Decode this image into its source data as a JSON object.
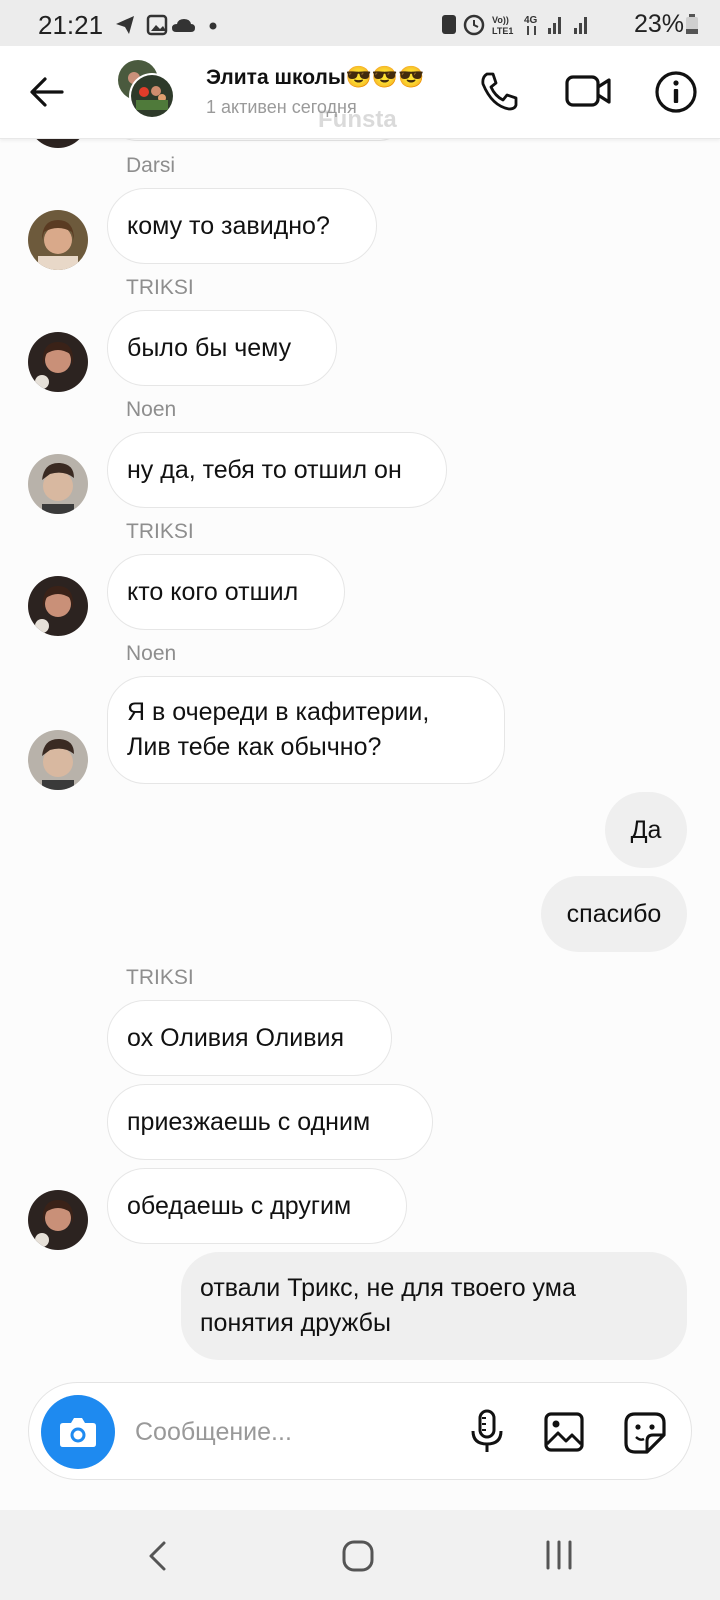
{
  "status_bar": {
    "time": "21:21",
    "battery": "23%",
    "network": [
      "Vo) LTE1",
      "4G"
    ]
  },
  "header": {
    "title": "Элита школы😎😎😎",
    "subtitle": "1 активен сегодня",
    "watermark": "Funsta"
  },
  "messages": [
    {
      "sender": "Darsi",
      "text": "кому то завидно?",
      "direction": "in"
    },
    {
      "sender": "TRIKSI",
      "text": "было бы чему",
      "direction": "in"
    },
    {
      "sender": "Noen",
      "text": "ну да, тебя то отшил он",
      "direction": "in"
    },
    {
      "sender": "TRIKSI",
      "text": "кто кого отшил",
      "direction": "in"
    },
    {
      "sender": "Noen",
      "lines": [
        "Я в очереди в кафитерии,",
        "Лив тебе как обычно?"
      ],
      "direction": "in"
    },
    {
      "text": "Да",
      "direction": "out"
    },
    {
      "text": "спасибо",
      "direction": "out"
    },
    {
      "sender": "TRIKSI",
      "text": "ох Оливия Оливия",
      "direction": "in"
    },
    {
      "text": "приезжаешь с одним",
      "direction": "in"
    },
    {
      "text": "обедаешь с другим",
      "direction": "in"
    },
    {
      "lines": [
        "отвали Трикс, не для твоего ума",
        "понятия дружбы"
      ],
      "direction": "out"
    }
  ],
  "composer": {
    "placeholder": "Сообщение..."
  },
  "colors": {
    "accent": "#1e8af0",
    "incoming_bubble": "#ffffff",
    "outgoing_bubble": "#efefef"
  }
}
